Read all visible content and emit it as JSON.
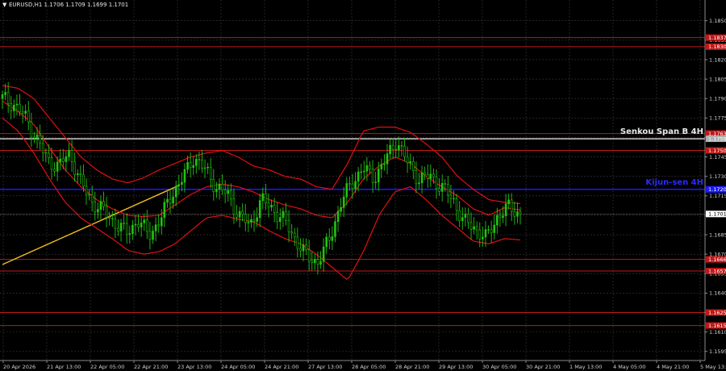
{
  "header": {
    "title": "EURUSD,H1  1.1706 1.1709 1.1699 1.1701"
  },
  "colors": {
    "background": "#000000",
    "grid": "#3a3a3a",
    "candle": "#22c40f",
    "bands": "#e01010",
    "kijun": "#1a1aff",
    "senkou": "#e0e0e0",
    "level": "#c01818",
    "trendline": "#f2c01c",
    "axis_text": "#d0d0d0"
  },
  "chart_data": {
    "type": "candlestick",
    "symbol": "EURUSD",
    "timeframe": "H1",
    "ylim": [
      1.1588,
      1.1866
    ],
    "y_ticks": [
      "1.1850",
      "1.1835",
      "1.1820",
      "1.1805",
      "1.1790",
      "1.1775",
      "1.1760",
      "1.1745",
      "1.1730",
      "1.1715",
      "1.1700",
      "1.1685",
      "1.1670",
      "1.1655",
      "1.1640",
      "1.1625",
      "1.1610",
      "1.1595"
    ],
    "x_ticks": [
      "20 Apr 2026",
      "21 Apr 13:00",
      "22 Apr 05:00",
      "22 Apr 21:00",
      "23 Apr 13:00",
      "24 Apr 05:00",
      "24 Apr 21:00",
      "27 Apr 13:00",
      "28 Apr 05:00",
      "28 Apr 21:00",
      "29 Apr 13:00",
      "30 Apr 05:00",
      "30 Apr 21:00",
      "1 May 13:00",
      "4 May 05:00",
      "4 May 21:00",
      "5 May 13:00"
    ],
    "current_price": "1.1701",
    "horizontal_levels": [
      {
        "value": 1.1837,
        "label": "1.1837",
        "kind": "level"
      },
      {
        "value": 1.183,
        "label": "1.1830",
        "kind": "level"
      },
      {
        "value": 1.1763,
        "label": "1.1763",
        "kind": "level"
      },
      {
        "value": 1.1759,
        "label": "1.1759",
        "kind": "senkou"
      },
      {
        "value": 1.175,
        "label": "1.1750",
        "kind": "level"
      },
      {
        "value": 1.172,
        "label": "1.1720",
        "kind": "kijun"
      },
      {
        "value": 1.1666,
        "label": "1.1666",
        "kind": "level"
      },
      {
        "value": 1.1657,
        "label": "1.1657",
        "kind": "level"
      },
      {
        "value": 1.1625,
        "label": "1.1625",
        "kind": "level"
      },
      {
        "value": 1.1615,
        "label": "1.1615",
        "kind": "level"
      }
    ],
    "annotations": {
      "senkou": "Senkou Span B 4H",
      "kijun": "Kijun-sen 4H"
    },
    "trendline": {
      "from": {
        "bar": 0,
        "price": 1.1662
      },
      "to": {
        "bar": 61,
        "price": 1.1723
      }
    },
    "ma_path": [
      1.1788,
      1.178,
      1.177,
      1.1752,
      1.1735,
      1.1722,
      1.1712,
      1.1705,
      1.17,
      1.1699,
      1.17,
      1.1708,
      1.1716,
      1.1722,
      1.1724,
      1.1722,
      1.1718,
      1.1712,
      1.1708,
      1.1705,
      1.17,
      1.1698,
      1.171,
      1.1728,
      1.1738,
      1.1745,
      1.174,
      1.173,
      1.1722,
      1.1715,
      1.1705,
      1.17,
      1.1706,
      1.1704
    ],
    "upper_band_path": [
      1.18,
      1.1798,
      1.179,
      1.1775,
      1.176,
      1.1745,
      1.1735,
      1.1728,
      1.1725,
      1.1729,
      1.1735,
      1.174,
      1.1745,
      1.1748,
      1.175,
      1.1745,
      1.1738,
      1.1735,
      1.173,
      1.1728,
      1.1722,
      1.172,
      1.174,
      1.1765,
      1.1768,
      1.1768,
      1.1764,
      1.1755,
      1.1745,
      1.173,
      1.172,
      1.1712,
      1.171,
      1.1709
    ],
    "lower_band_path": [
      1.1775,
      1.1765,
      1.1748,
      1.1728,
      1.171,
      1.1698,
      1.169,
      1.1682,
      1.1673,
      1.167,
      1.1672,
      1.1678,
      1.1688,
      1.1698,
      1.17,
      1.1697,
      1.1695,
      1.1688,
      1.1682,
      1.1678,
      1.167,
      1.166,
      1.165,
      1.1672,
      1.17,
      1.1718,
      1.1722,
      1.1712,
      1.17,
      1.169,
      1.168,
      1.1678,
      1.1682,
      1.1681
    ],
    "price_path": [
      1.179,
      1.1786,
      1.1776,
      1.176,
      1.1742,
      1.1738,
      1.1748,
      1.1724,
      1.171,
      1.1703,
      1.1694,
      1.1686,
      1.1696,
      1.1685,
      1.1696,
      1.1716,
      1.1728,
      1.1745,
      1.1735,
      1.1722,
      1.1716,
      1.17,
      1.1692,
      1.1712,
      1.1705,
      1.1696,
      1.1682,
      1.1668,
      1.1664,
      1.168,
      1.1708,
      1.1725,
      1.1736,
      1.1729,
      1.1742,
      1.1758,
      1.174,
      1.1728,
      1.173,
      1.1722,
      1.1712,
      1.1695,
      1.169,
      1.1682,
      1.17,
      1.1706,
      1.1701
    ],
    "bar_count": 180
  }
}
